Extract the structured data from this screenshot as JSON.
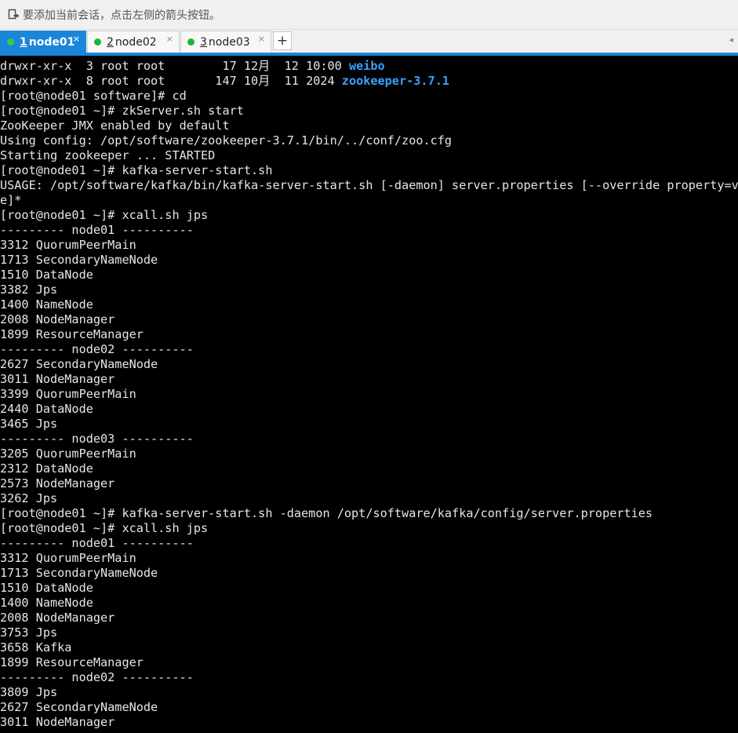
{
  "hint_bar": {
    "text": "要添加当前会话，点击左侧的箭头按钮。"
  },
  "tabs": [
    {
      "num": "1",
      "label": " node01",
      "active": true
    },
    {
      "num": "2",
      "label": " node02",
      "active": false
    },
    {
      "num": "3",
      "label": " node03",
      "active": false
    }
  ],
  "tab_close_glyph": "×",
  "tab_add_label": "+",
  "tab_scroll_glyph": "◂",
  "colors": {
    "accent": "#1a86d9",
    "terminal_bg": "#000000",
    "terminal_fg": "#e6e6e6",
    "dir_highlight": "#3aa0ff",
    "status_dot": "#1fb53a"
  },
  "terminal": {
    "lines": [
      {
        "text": "drwxr-xr-x  3 root root        17 12月  12 10:00 ",
        "hl": "weibo"
      },
      {
        "text": "drwxr-xr-x  8 root root       147 10月  11 2024 ",
        "hl": "zookeeper-3.7.1"
      },
      {
        "text": "[root@node01 software]# cd"
      },
      {
        "text": "[root@node01 ~]# zkServer.sh start"
      },
      {
        "text": "ZooKeeper JMX enabled by default"
      },
      {
        "text": "Using config: /opt/software/zookeeper-3.7.1/bin/../conf/zoo.cfg"
      },
      {
        "text": "Starting zookeeper ... STARTED"
      },
      {
        "text": "[root@node01 ~]# kafka-server-start.sh"
      },
      {
        "text": "USAGE: /opt/software/kafka/bin/kafka-server-start.sh [-daemon] server.properties [--override property=val"
      },
      {
        "text": "e]*"
      },
      {
        "text": "[root@node01 ~]# xcall.sh jps"
      },
      {
        "text": "--------- node01 ----------"
      },
      {
        "text": "3312 QuorumPeerMain"
      },
      {
        "text": "1713 SecondaryNameNode"
      },
      {
        "text": "1510 DataNode"
      },
      {
        "text": "3382 Jps"
      },
      {
        "text": "1400 NameNode"
      },
      {
        "text": "2008 NodeManager"
      },
      {
        "text": "1899 ResourceManager"
      },
      {
        "text": "--------- node02 ----------"
      },
      {
        "text": "2627 SecondaryNameNode"
      },
      {
        "text": "3011 NodeManager"
      },
      {
        "text": "3399 QuorumPeerMain"
      },
      {
        "text": "2440 DataNode"
      },
      {
        "text": "3465 Jps"
      },
      {
        "text": "--------- node03 ----------"
      },
      {
        "text": "3205 QuorumPeerMain"
      },
      {
        "text": "2312 DataNode"
      },
      {
        "text": "2573 NodeManager"
      },
      {
        "text": "3262 Jps"
      },
      {
        "text": "[root@node01 ~]# kafka-server-start.sh -daemon /opt/software/kafka/config/server.properties"
      },
      {
        "text": "[root@node01 ~]# xcall.sh jps"
      },
      {
        "text": "--------- node01 ----------"
      },
      {
        "text": "3312 QuorumPeerMain"
      },
      {
        "text": "1713 SecondaryNameNode"
      },
      {
        "text": "1510 DataNode"
      },
      {
        "text": "1400 NameNode"
      },
      {
        "text": "2008 NodeManager"
      },
      {
        "text": "3753 Jps"
      },
      {
        "text": "3658 Kafka"
      },
      {
        "text": "1899 ResourceManager"
      },
      {
        "text": "--------- node02 ----------"
      },
      {
        "text": "3809 Jps"
      },
      {
        "text": "2627 SecondaryNameNode"
      },
      {
        "text": "3011 NodeManager"
      }
    ]
  }
}
